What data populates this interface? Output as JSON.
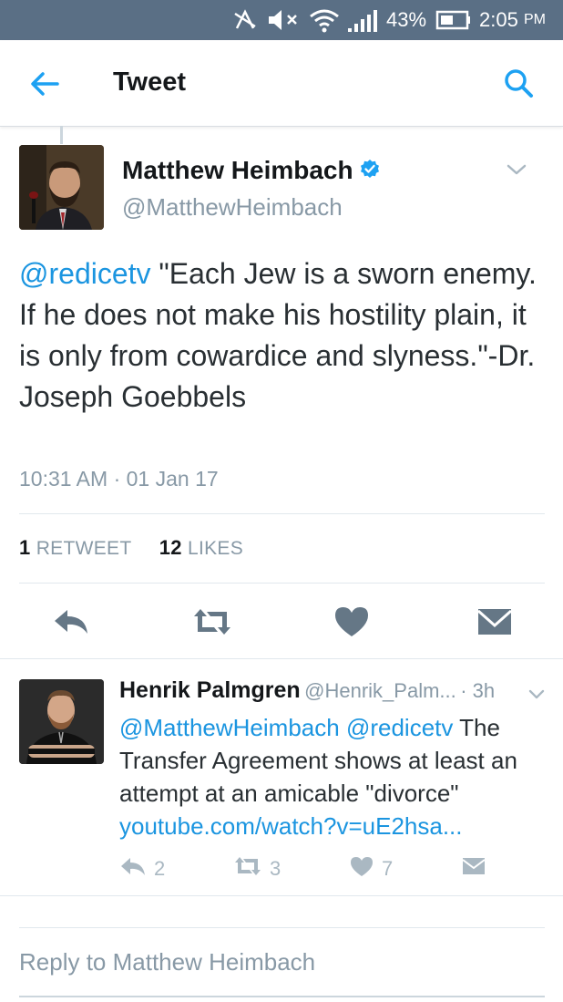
{
  "status_bar": {
    "battery": "43%",
    "time": "2:05",
    "ampm": "PM",
    "icons": [
      "data-off-icon",
      "mute-icon",
      "wifi-icon",
      "signal-icon",
      "battery-icon"
    ]
  },
  "app_bar": {
    "title": "Tweet",
    "icons": [
      "back-arrow-icon",
      "search-icon"
    ],
    "accent": "#1da1f2"
  },
  "tweet": {
    "author_name": "Matthew Heimbach",
    "author_handle": "@MatthewHeimbach",
    "verified": true,
    "mention": "@redicetv",
    "body": " \"Each Jew is a sworn enemy. If he does not make his hostility plain, it is only from cowardice and slyness.\"-Dr. Joseph Goebbels",
    "timestamp": "10:31 AM · 01 Jan 17",
    "retweets_count": "1",
    "retweets_label": "RETWEET",
    "likes_count": "12",
    "likes_label": "LIKES",
    "actions": [
      "reply-icon",
      "retweet-icon",
      "like-icon",
      "direct-message-icon"
    ]
  },
  "reply": {
    "author_name": "Henrik Palmgren",
    "author_handle": "@Henrik_Palm...",
    "age": "· 3h",
    "mention1": "@MatthewHeimbach",
    "mention2": "@redicetv",
    "body": " The Transfer Agreement shows at least an attempt at an amicable \"divorce\"",
    "link": "youtube.com/watch?v=uE2hsa...",
    "reply_count": "2",
    "retweet_count": "3",
    "like_count": "7"
  },
  "compose": {
    "placeholder": "Reply to Matthew Heimbach"
  },
  "colors": {
    "link": "#1b95e0",
    "muted": "#8899a6",
    "status_bar": "#5a6f85"
  }
}
